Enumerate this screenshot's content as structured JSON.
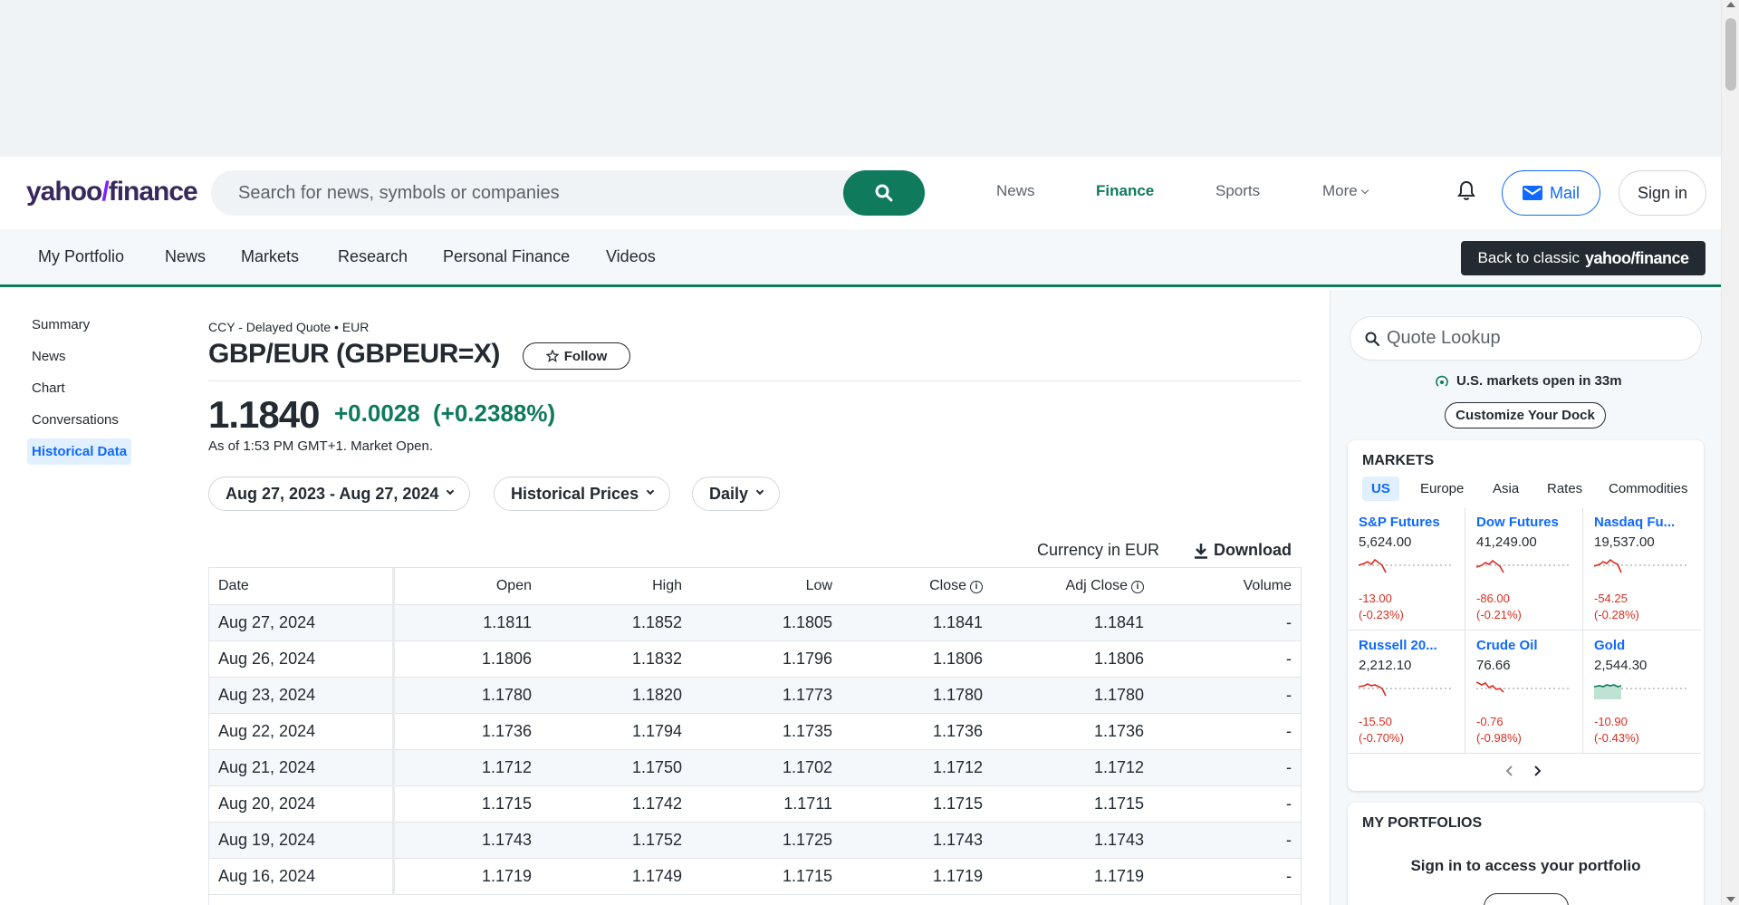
{
  "header": {
    "logo_text": "yahoo",
    "logo_slash": "/",
    "logo_suffix": "finance",
    "search_placeholder": "Search for news, symbols or companies",
    "nav": [
      "News",
      "Finance",
      "Sports",
      "More"
    ],
    "mail_label": "Mail",
    "signin_label": "Sign in"
  },
  "subnav": {
    "items": [
      "My Portfolio",
      "News",
      "Markets",
      "Research",
      "Personal Finance",
      "Videos"
    ],
    "classic_prefix": "Back to classic",
    "classic_brand": "yahoo/finance"
  },
  "leftnav": {
    "items": [
      "Summary",
      "News",
      "Chart",
      "Conversations",
      "Historical Data"
    ]
  },
  "quote": {
    "meta": "CCY - Delayed Quote • EUR",
    "title": "GBP/EUR (GBPEUR=X)",
    "follow_label": "Follow",
    "price": "1.1840",
    "change": "+0.0028",
    "change_pct": "(+0.2388%)",
    "as_of": "As of 1:53 PM GMT+1. Market Open."
  },
  "filters": {
    "date_range": "Aug 27, 2023 - Aug 27, 2024",
    "type": "Historical Prices",
    "frequency": "Daily"
  },
  "table": {
    "currency_label": "Currency in EUR",
    "download_label": "Download",
    "headers": [
      "Date",
      "Open",
      "High",
      "Low",
      "Close",
      "Adj Close",
      "Volume"
    ],
    "rows": [
      [
        "Aug 27, 2024",
        "1.1811",
        "1.1852",
        "1.1805",
        "1.1841",
        "1.1841",
        "-"
      ],
      [
        "Aug 26, 2024",
        "1.1806",
        "1.1832",
        "1.1796",
        "1.1806",
        "1.1806",
        "-"
      ],
      [
        "Aug 23, 2024",
        "1.1780",
        "1.1820",
        "1.1773",
        "1.1780",
        "1.1780",
        "-"
      ],
      [
        "Aug 22, 2024",
        "1.1736",
        "1.1794",
        "1.1735",
        "1.1736",
        "1.1736",
        "-"
      ],
      [
        "Aug 21, 2024",
        "1.1712",
        "1.1750",
        "1.1702",
        "1.1712",
        "1.1712",
        "-"
      ],
      [
        "Aug 20, 2024",
        "1.1715",
        "1.1742",
        "1.1711",
        "1.1715",
        "1.1715",
        "-"
      ],
      [
        "Aug 19, 2024",
        "1.1743",
        "1.1752",
        "1.1725",
        "1.1743",
        "1.1743",
        "-"
      ],
      [
        "Aug 16, 2024",
        "1.1719",
        "1.1749",
        "1.1715",
        "1.1719",
        "1.1719",
        "-"
      ]
    ]
  },
  "sidebar": {
    "lookup_placeholder": "Quote Lookup",
    "market_status": "U.S. markets open in 33m",
    "dock_label": "Customize Your Dock",
    "markets_title": "MARKETS",
    "tabs": [
      "US",
      "Europe",
      "Asia",
      "Rates",
      "Commodities"
    ],
    "tiles": [
      {
        "name": "S&P Futures",
        "price": "5,624.00",
        "change": "-13.00",
        "pct": "(-0.23%)"
      },
      {
        "name": "Dow Futures",
        "price": "41,249.00",
        "change": "-86.00",
        "pct": "(-0.21%)"
      },
      {
        "name": "Nasdaq Fu...",
        "price": "19,537.00",
        "change": "-54.25",
        "pct": "(-0.28%)"
      },
      {
        "name": "Russell 20...",
        "price": "2,212.10",
        "change": "-15.50",
        "pct": "(-0.70%)"
      },
      {
        "name": "Crude Oil",
        "price": "76.66",
        "change": "-0.76",
        "pct": "(-0.98%)"
      },
      {
        "name": "Gold",
        "price": "2,544.30",
        "change": "-10.90",
        "pct": "(-0.43%)"
      }
    ],
    "portfolios_title": "MY PORTFOLIOS",
    "portfolios_msg": "Sign in to access your portfolio"
  },
  "colors": {
    "brand_green": "#0f7a5c",
    "link_blue": "#0f69ff",
    "down_red": "#d92e20",
    "logo_purple": "#39285c"
  }
}
